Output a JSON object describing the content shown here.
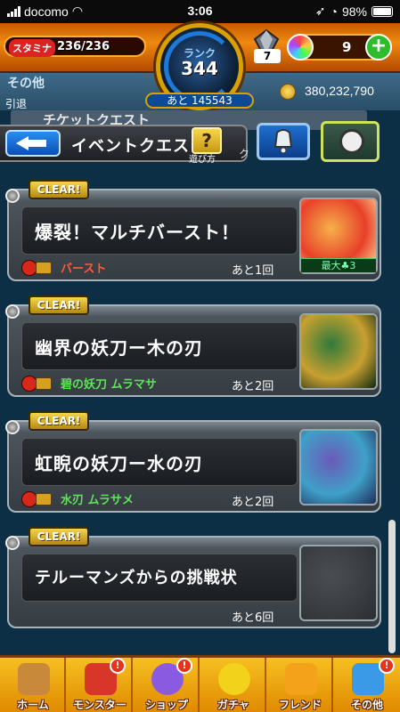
{
  "statusbar": {
    "carrier": "docomo",
    "time": "3:06",
    "battery": "98%"
  },
  "header": {
    "stamina_label": "スタミナ",
    "stamina": "236/236",
    "rank_label": "ランク",
    "rank": "344",
    "exp_next": "あと 145543",
    "gem_count": "7",
    "orb_count": "9"
  },
  "subheader": {
    "title": "その他",
    "retire": "引退",
    "coins": "380,232,790",
    "ticket_text": "チケットクエスト",
    "cu_text": "ク"
  },
  "event_bar": {
    "title": "イベントクエスト",
    "help_label": "遊び方"
  },
  "quests": [
    {
      "badge": "CLEAR!",
      "name": "爆裂！マルチバースト！",
      "boss": "バースト",
      "boss_color": "#ff5a3a",
      "remaining": "あと1回",
      "max_label": "最大♣3",
      "portrait_colors": [
        "#f5b14a",
        "#e8402a",
        "#fbe8a0"
      ]
    },
    {
      "badge": "CLEAR!",
      "name": "幽界の妖刀ー木の刃",
      "boss": "碧の妖刀 ムラマサ",
      "boss_color": "#5fe35a",
      "remaining": "あと2回",
      "portrait_colors": [
        "#2f7a3a",
        "#c8a030",
        "#0e2a12"
      ]
    },
    {
      "badge": "CLEAR!",
      "name": "虹睨の妖刀ー水の刃",
      "boss": "水刃 ムラサメ",
      "boss_color": "#5fe35a",
      "remaining": "あと2回",
      "portrait_colors": [
        "#6a5ab8",
        "#3fa0c8",
        "#1e2e5a"
      ]
    },
    {
      "badge": "CLEAR!",
      "name": "テルーマンズからの挑戦状",
      "boss": "",
      "boss_color": "#ffffff",
      "remaining": "あと6回",
      "portrait_colors": [
        "#4a4e52",
        "#3a3e42",
        "#2a2e32"
      ]
    }
  ],
  "bottom_nav": [
    {
      "label": "ホーム",
      "icon": "home-icon",
      "color": "#c88a3a",
      "badge": ""
    },
    {
      "label": "モンスター",
      "icon": "monster-icon",
      "color": "#d9362a",
      "badge": "!"
    },
    {
      "label": "ショップ",
      "icon": "shop-orb-icon",
      "color": "#8a5ae0",
      "badge": "!"
    },
    {
      "label": "ガチャ",
      "icon": "gacha-icon",
      "color": "#f2d21a",
      "badge": ""
    },
    {
      "label": "フレンド",
      "icon": "friend-icon",
      "color": "#f4a21a",
      "badge": ""
    },
    {
      "label": "その他",
      "icon": "other-icon",
      "color": "#3a9ae8",
      "badge": "!"
    }
  ]
}
